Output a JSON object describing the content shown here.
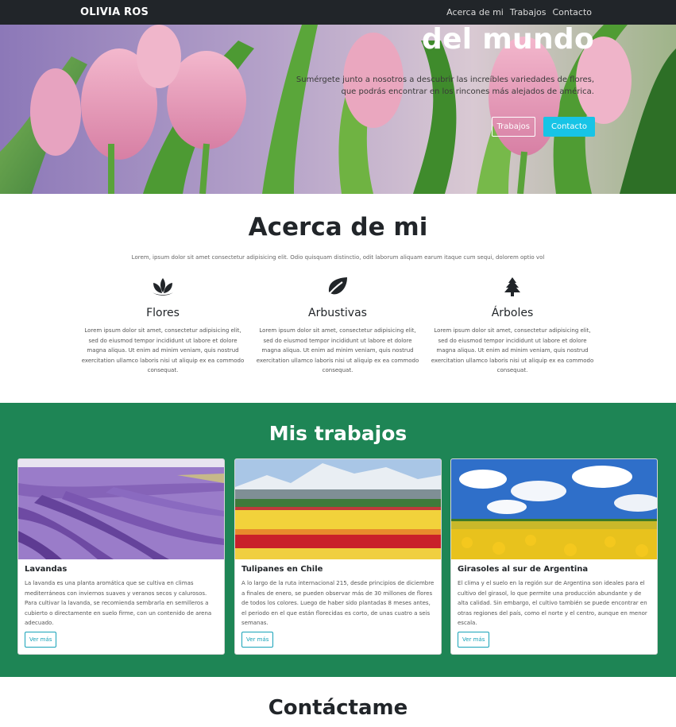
{
  "navbar": {
    "brand": "OLIVIA ROS",
    "links": [
      "Acerca de mi",
      "Trabajos",
      "Contacto"
    ]
  },
  "hero": {
    "title": "del mundo",
    "text": "Sumérgete junto a nosotros a descubrir las increíbles variedades de flores, que podrás encontrar en los rincones más alejados de américa.",
    "btn_works": "Trabajos",
    "btn_contact": "Contacto"
  },
  "about": {
    "title": "Acerca de mi",
    "lead": "Lorem, ipsum dolor sit amet consectetur adipisicing elit. Odio quisquam distinctio, odit laborum aliquam earum itaque cum sequi, dolorem optio vol",
    "features": [
      {
        "icon": "lotus-icon",
        "title": "Flores",
        "text": "Lorem ipsum dolor sit amet, consectetur adipisicing elit, sed do eiusmod tempor incididunt ut labore et dolore magna aliqua. Ut enim ad minim veniam, quis nostrud exercitation ullamco laboris nisi ut aliquip ex ea commodo consequat."
      },
      {
        "icon": "leaf-icon",
        "title": "Arbustivas",
        "text": "Lorem ipsum dolor sit amet, consectetur adipisicing elit, sed do eiusmod tempor incididunt ut labore et dolore magna aliqua. Ut enim ad minim veniam, quis nostrud exercitation ullamco laboris nisi ut aliquip ex ea commodo consequat."
      },
      {
        "icon": "tree-icon",
        "title": "Árboles",
        "text": "Lorem ipsum dolor sit amet, consectetur adipisicing elit, sed do eiusmod tempor incididunt ut labore et dolore magna aliqua. Ut enim ad minim veniam, quis nostrud exercitation ullamco laboris nisi ut aliquip ex ea commodo consequat."
      }
    ]
  },
  "works": {
    "title": "Mis trabajos",
    "cards": [
      {
        "title": "Lavandas",
        "text": "La lavanda es una planta aromática que se cultiva en climas mediterráneos con inviernos suaves y veranos secos y calurosos. Para cultivar la lavanda, se recomienda sembrarla en semilleros a cubierto o directamente en suelo firme, con un contenido de arena adecuado.",
        "button": "Ver más"
      },
      {
        "title": "Tulipanes en Chile",
        "text": "A lo largo de la ruta internacional 215, desde principios de diciembre a finales de enero, se pueden observar más de 30 millones de flores de todos los colores. Luego de haber sido plantadas 8 meses antes, el periodo en el que están florecidas es corto, de unas cuatro a seis semanas.",
        "button": "Ver más"
      },
      {
        "title": "Girasoles al sur de Argentina",
        "text": "El clima y el suelo en la región sur de Argentina son ideales para el cultivo del girasol, lo que permite una producción abundante y de alta calidad. Sin embargo, el cultivo también se puede encontrar en otras regiones del país, como el norte y el centro, aunque en menor escala.",
        "button": "Ver más"
      }
    ]
  },
  "contact": {
    "title": "Contáctame"
  },
  "colors": {
    "navbar": "#212529",
    "works_bg": "#1e8555",
    "info": "#17c4e6"
  }
}
